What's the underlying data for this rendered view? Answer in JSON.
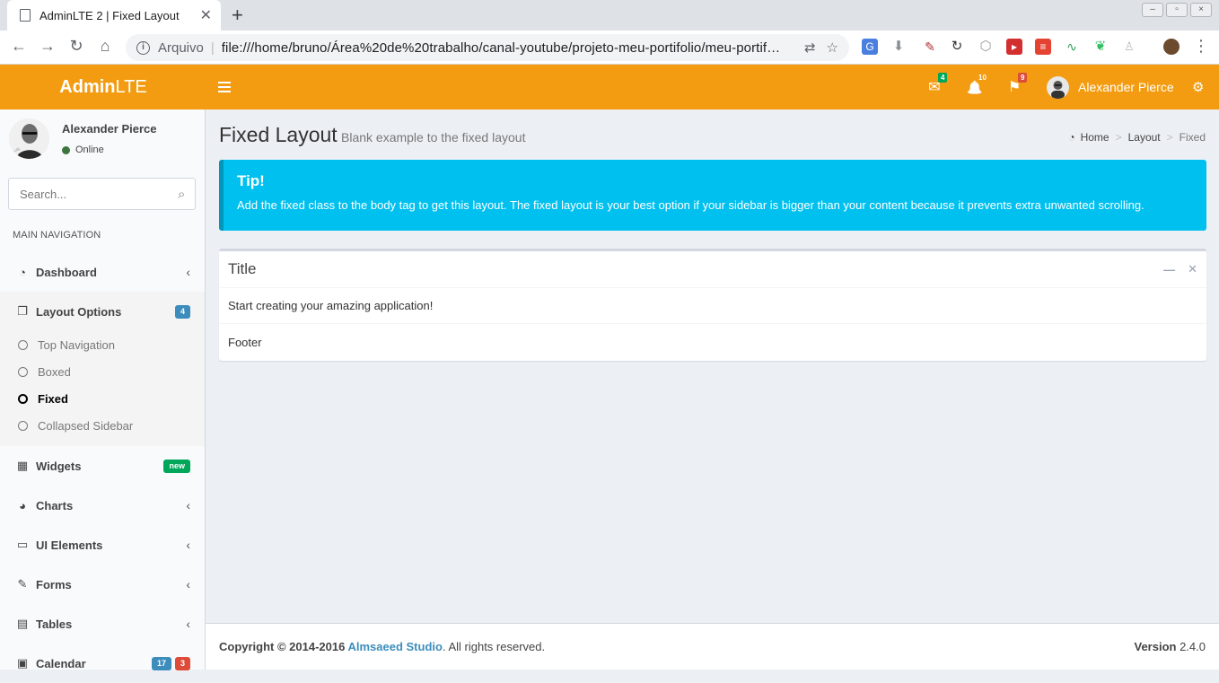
{
  "browser": {
    "tab_title": "AdminLTE 2 | Fixed Layout",
    "close_glyph": "✕",
    "newtab_glyph": "+",
    "security_label": "Arquivo",
    "url": "file:///home/bruno/Área%20de%20trabalho/canal-youtube/projeto-meu-portifolio/meu-portif…",
    "back_glyph": "←",
    "forward_glyph": "→",
    "reload_glyph": "↻",
    "home_glyph": "⌂",
    "menu_glyph": "⋮",
    "star_glyph": "☆",
    "translate_glyph": "⇄"
  },
  "header": {
    "logo_bold": "Admin",
    "logo_light": "LTE",
    "messages_count": "4",
    "notifications_count": "10",
    "tasks_count": "9",
    "user_name": "Alexander Pierce",
    "messages_icon": "✉",
    "notifications_icon": "🔔",
    "tasks_icon": "⚑",
    "gears_icon": "⚙"
  },
  "sidebar": {
    "user_name": "Alexander Pierce",
    "status": "Online",
    "search_placeholder": "Search...",
    "search_icon": "⌕",
    "menu_header": "MAIN NAVIGATION",
    "items": [
      {
        "label": "Dashboard",
        "icon": "◔",
        "chevron": "‹"
      },
      {
        "label": "Layout Options",
        "icon": "❐",
        "badge": "4"
      },
      {
        "label": "Widgets",
        "icon": "▦",
        "badge": "new"
      },
      {
        "label": "Charts",
        "icon": "◕",
        "chevron": "‹"
      },
      {
        "label": "UI Elements",
        "icon": "▭",
        "chevron": "‹"
      },
      {
        "label": "Forms",
        "icon": "✎",
        "chevron": "‹"
      },
      {
        "label": "Tables",
        "icon": "▤",
        "chevron": "‹"
      },
      {
        "label": "Calendar",
        "icon": "▣",
        "badge1": "17",
        "badge2": "3"
      }
    ],
    "layout_sub": [
      "Top Navigation",
      "Boxed",
      "Fixed",
      "Collapsed Sidebar"
    ]
  },
  "content": {
    "title": "Fixed Layout",
    "subtitle": "Blank example to the fixed layout",
    "breadcrumb": {
      "home": "Home",
      "layout": "Layout",
      "current": "Fixed",
      "sep": ">",
      "home_icon": "◔"
    },
    "callout_title": "Tip!",
    "callout_text": "Add the fixed class to the body tag to get this layout. The fixed layout is your best option if your sidebar is bigger than your content because it prevents extra unwanted scrolling.",
    "box_title": "Title",
    "box_body": "Start creating your amazing application!",
    "box_footer": "Footer",
    "collapse_glyph": "—",
    "remove_glyph": "✕"
  },
  "footer": {
    "copyright": "Copyright © 2014-2016 ",
    "studio": "Almsaeed Studio",
    "rights": ". All rights reserved.",
    "version_label": "Version",
    "version": " 2.4.0"
  },
  "colors": {
    "header": "#f39c12",
    "callout": "#00c0ef",
    "link": "#3c8dbc",
    "badge_blue": "#3c8dbc",
    "badge_green": "#00a65a",
    "badge_red": "#dd4b39"
  }
}
